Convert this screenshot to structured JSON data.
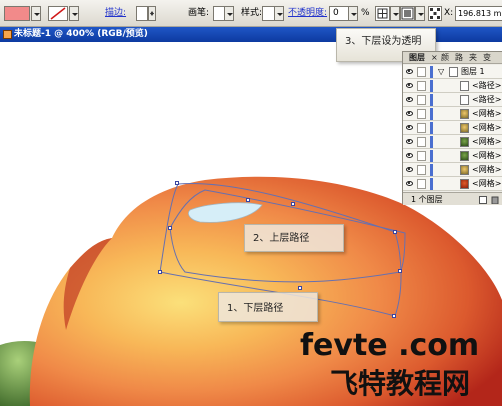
{
  "control_bar": {
    "fill_color": "#f28a8a",
    "stroke_label": "描边:",
    "brush_label": "画笔:",
    "style_label": "样式:",
    "opacity_label": "不透明度:",
    "opacity_value": "0",
    "opacity_unit": "%",
    "x_label": "X:",
    "x_value": "196.813 m"
  },
  "document": {
    "title": "未标题-1 @ 400% (RGB/预览)"
  },
  "layers_panel": {
    "tabs": [
      "图层",
      "×",
      "颜",
      "路",
      "夹",
      "变"
    ],
    "layers": [
      {
        "name": "图层 1",
        "thumb": "layer"
      },
      {
        "name": "<路径>",
        "thumb": "path"
      },
      {
        "name": "<路径>",
        "thumb": "path"
      },
      {
        "name": "<网格>",
        "thumb": "mesh"
      },
      {
        "name": "<网格>",
        "thumb": "mesh"
      },
      {
        "name": "<网格>",
        "thumb": "mesh2"
      },
      {
        "name": "<网格>",
        "thumb": "mesh2"
      },
      {
        "name": "<网格>",
        "thumb": "mesh"
      },
      {
        "name": "<网格>",
        "thumb": "mesh3"
      }
    ],
    "footer": "1 个图层"
  },
  "callouts": {
    "step1": "1、下层路径",
    "step2": "2、上层路径",
    "step3": "3、下层设为透明"
  },
  "watermark": {
    "latin": "fevte .com",
    "cjk": "飞特教程网"
  },
  "colors": {
    "titlebar": "#1f56c6",
    "path_stroke": "#6670b0",
    "peach_center": "#f7c25a",
    "peach_edge": "#c8301a"
  }
}
